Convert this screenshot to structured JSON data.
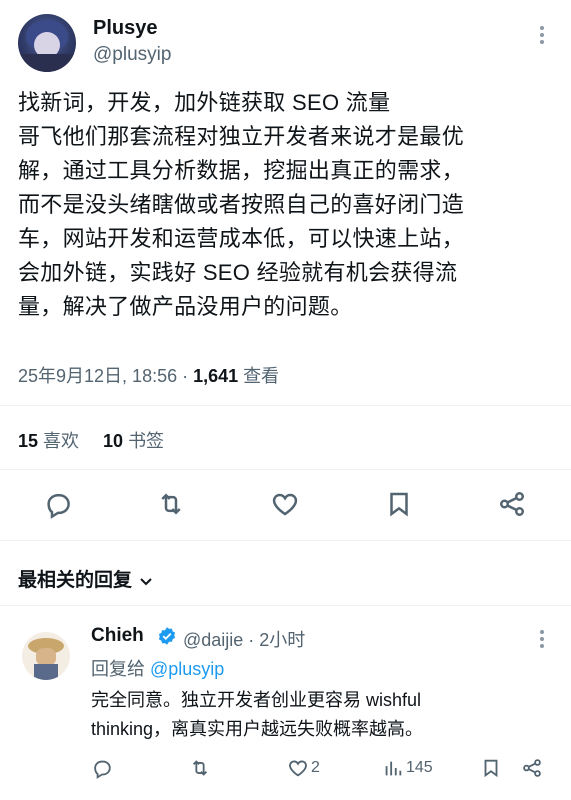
{
  "tweet": {
    "author_name": "Plusye",
    "author_handle": "@plusyip",
    "text_lines": [
      "找新词，开发，加外链获取 SEO 流量",
      "哥飞他们那套流程对独立开发者来说才是最优",
      "解，通过工具分析数据，挖掘出真正的需求，",
      "而不是没头绪瞎做或者按照自己的喜好闭门造",
      "车，网站开发和运营成本低，可以快速上站，",
      "会加外链，实践好 SEO 经验就有机会获得流",
      "量，解决了做产品没用户的问题。"
    ],
    "timestamp": "25年9月12日, 18:56 · ",
    "views_count": "1,641",
    "views_label": " 查看",
    "likes_count": "15",
    "likes_label": "喜欢",
    "bookmarks_count": "10",
    "bookmarks_label": "书签"
  },
  "actions": [
    "reply-icon",
    "retweet-icon",
    "like-icon",
    "bookmark-icon",
    "share-icon"
  ],
  "replies_section": {
    "title": "最相关的回复"
  },
  "reply": {
    "author_name": "Chieh",
    "author_handle": "@daijie · 2小时",
    "replying_prefix": "回复给 ",
    "replying_to": "@plusyip",
    "text_lines": [
      "完全同意。独立开发者创业更容易 wishful",
      "thinking，离真实用户越远失败概率越高。"
    ],
    "likes": "2",
    "views": "145"
  },
  "colors": {
    "text": "#0f1419",
    "secondary": "#536471",
    "accent": "#1d9bf0",
    "separator": "#eff3f4"
  }
}
